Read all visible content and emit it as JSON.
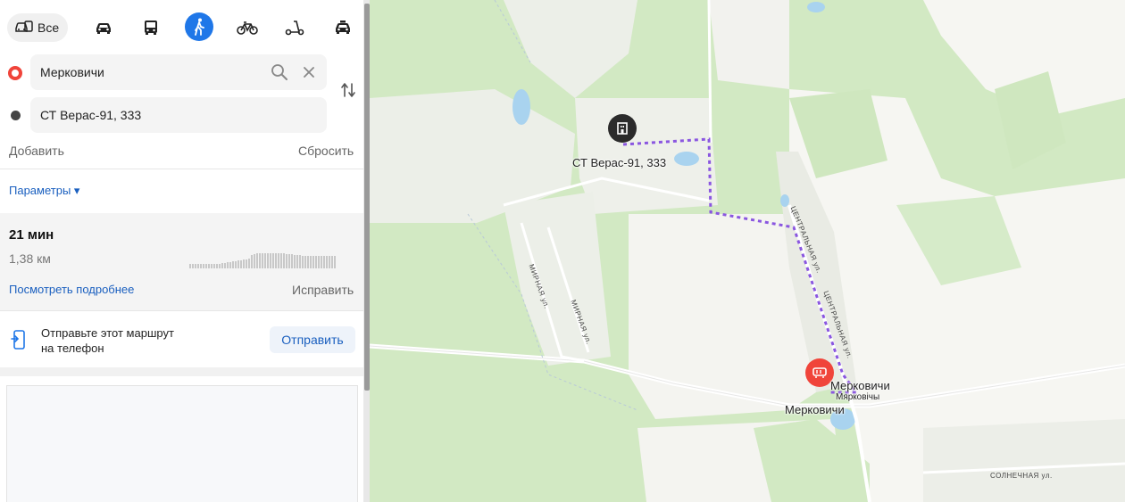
{
  "transport_modes": {
    "all_label": "Все",
    "items": [
      {
        "icon": "car-icon",
        "active": false
      },
      {
        "icon": "bus-icon",
        "active": false
      },
      {
        "icon": "pedestrian-icon",
        "active": true
      },
      {
        "icon": "bicycle-icon",
        "active": false
      },
      {
        "icon": "scooter-icon",
        "active": false
      },
      {
        "icon": "taxi-icon",
        "active": false
      }
    ]
  },
  "route_points": {
    "from": {
      "value": "Мерковичи",
      "marker_color": "#f0443a"
    },
    "to": {
      "value": "СТ Верас-91, 333",
      "marker_color": "#444444"
    }
  },
  "actions": {
    "add_label": "Добавить",
    "reset_label": "Сбросить",
    "parameters_label": "Параметры ▾"
  },
  "route_summary": {
    "duration": "21 мин",
    "distance": "1,38 км",
    "details_link": "Посмотреть подробнее",
    "fix_link": "Исправить"
  },
  "send_to_phone": {
    "text_line1": "Отправьте этот маршрут",
    "text_line2": "на телефон",
    "button_label": "Отправить"
  },
  "map": {
    "destination_label": "СТ Верас-91, 333",
    "origin_label_ru": "Мерковичи",
    "origin_label_by": "Мяркoвiчы",
    "origin_road_label": "Мерковичи",
    "streets": {
      "mirnaya_1": "МИРНАЯ ул.",
      "mirnaya_2": "МИРНАЯ ул.",
      "central_1": "ЦЕНТРАЛЬНАЯ ул.",
      "central_2": "ЦЕНТРАЛЬНАЯ ул.",
      "solnechnaya": "СОЛНЕЧНАЯ ул."
    },
    "route_color": "#8a56e0",
    "origin_pin_color": "#f0443a",
    "destination_pin_color": "#2b2b2b"
  },
  "colors": {
    "accent": "#1f77e8",
    "link": "#1a5fbf"
  }
}
